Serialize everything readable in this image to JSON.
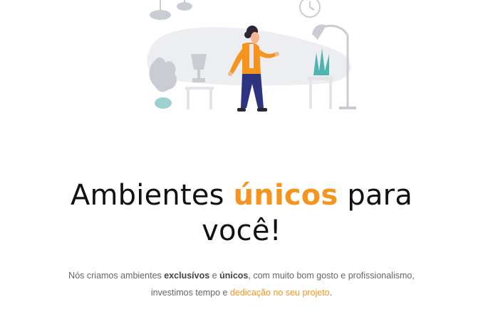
{
  "hero": {
    "illustration_label": "person-in-living-room",
    "headline": {
      "part1": "Ambientes ",
      "accent": "únicos",
      "part2": " para",
      "line2": "você!"
    },
    "description": {
      "t1": "Nós criamos ambientes ",
      "b1": "exclusívos",
      "t2": " e ",
      "b2": "únicos",
      "t3": ", com muito bom gosto e profissionalismo,",
      "t4": "investimos tempo e ",
      "highlight": "dedicação no seu projeto",
      "t5": "."
    }
  },
  "colors": {
    "accent": "#f7941d",
    "text": "#111111",
    "muted": "#666666",
    "illustration_gray": "#c9cdd3",
    "illustration_bg": "#eceef1"
  }
}
